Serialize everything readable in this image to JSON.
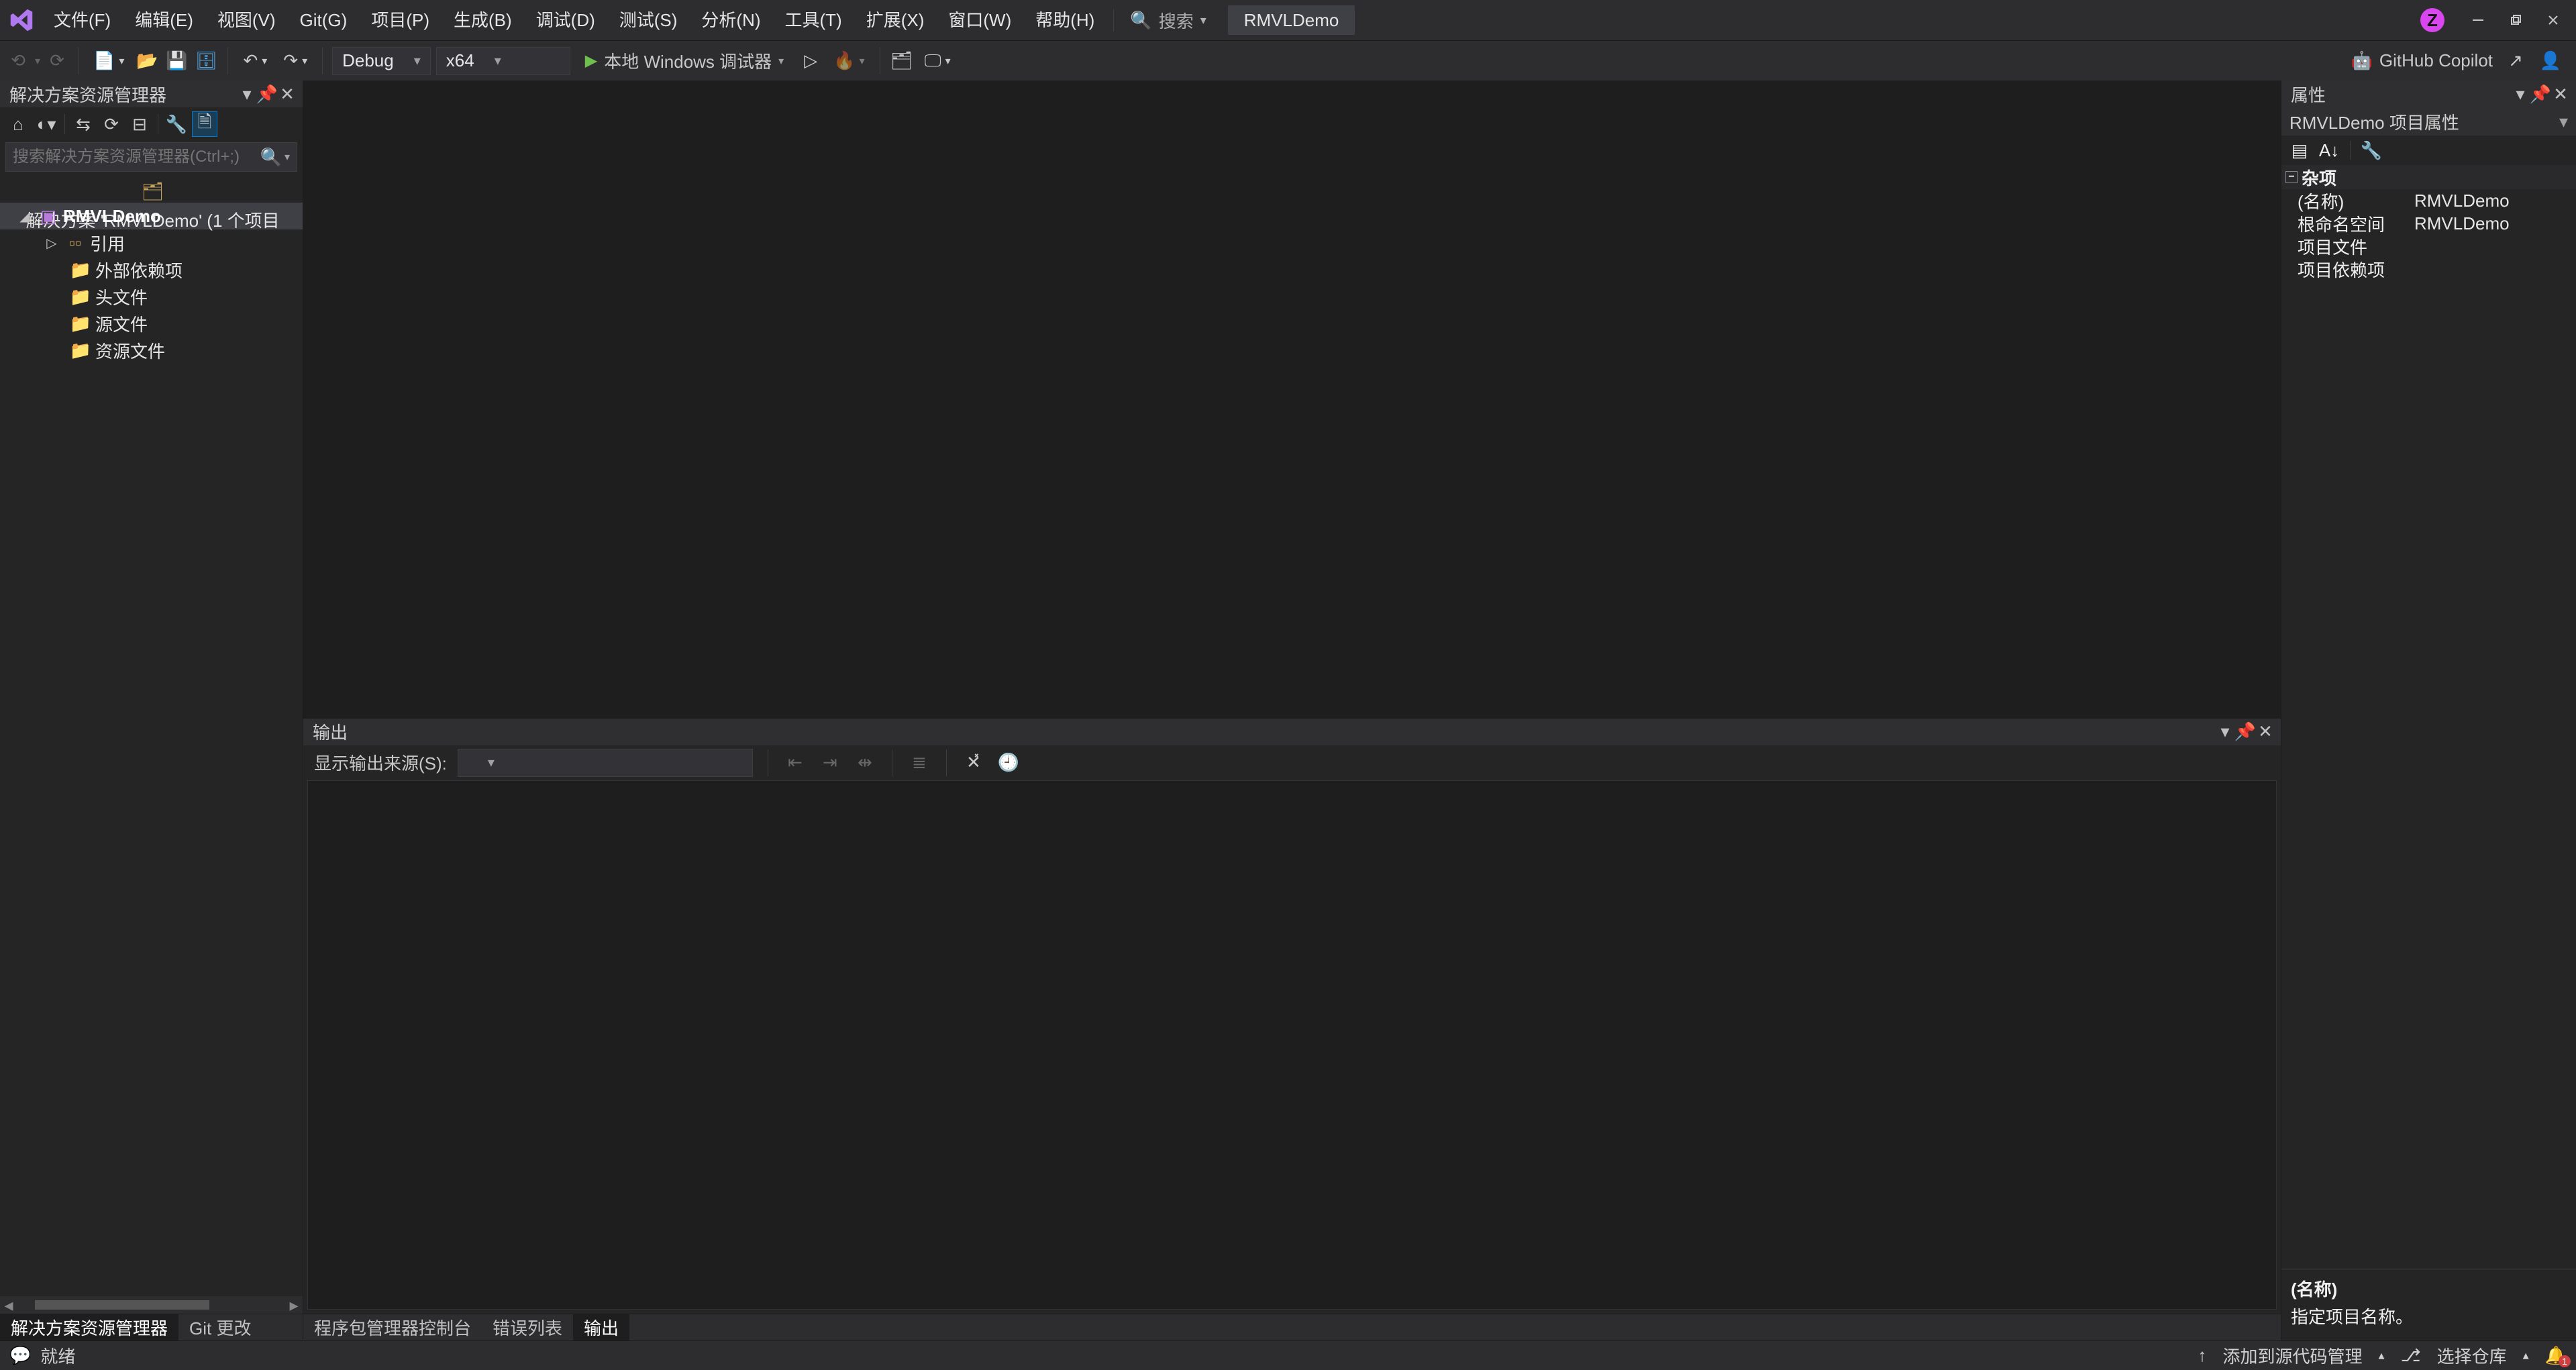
{
  "menubar": {
    "items": [
      "文件(F)",
      "编辑(E)",
      "视图(V)",
      "Git(G)",
      "项目(P)",
      "生成(B)",
      "调试(D)",
      "测试(S)",
      "分析(N)",
      "工具(T)",
      "扩展(X)",
      "窗口(W)",
      "帮助(H)"
    ],
    "search_label": "搜索",
    "project_pill": "RMVLDemo",
    "avatar_initial": "Z"
  },
  "toolbar": {
    "config_combo": "Debug",
    "platform_combo": "x64",
    "debug_target": "本地 Windows 调试器",
    "copilot_label": "GitHub Copilot"
  },
  "solution_explorer": {
    "title": "解决方案资源管理器",
    "search_placeholder": "搜索解决方案资源管理器(Ctrl+;)",
    "root_label": "解决方案 'RMVLDemo' (1 个项目",
    "project_label": "RMVLDemo",
    "children": [
      "引用",
      "外部依赖项",
      "头文件",
      "源文件",
      "资源文件"
    ]
  },
  "left_tabs": {
    "active": "解决方案资源管理器",
    "other": "Git 更改"
  },
  "editor_tabs": {
    "items": [
      "程序包管理器控制台",
      "错误列表",
      "输出"
    ],
    "active_index": 2
  },
  "output": {
    "title": "输出",
    "source_label": "显示输出来源(S):",
    "source_value": ""
  },
  "properties": {
    "title": "属性",
    "object_label": "RMVLDemo 项目属性",
    "category": "杂项",
    "rows": [
      {
        "k": "(名称)",
        "v": "RMVLDemo"
      },
      {
        "k": "根命名空间",
        "v": "RMVLDemo"
      },
      {
        "k": "项目文件",
        "v": ""
      },
      {
        "k": "项目依赖项",
        "v": ""
      }
    ],
    "desc_title": "(名称)",
    "desc_body": "指定项目名称。"
  },
  "statusbar": {
    "ready": "就绪",
    "add_source_control": "添加到源代码管理",
    "select_repo": "选择仓库",
    "notification_count": "1"
  }
}
